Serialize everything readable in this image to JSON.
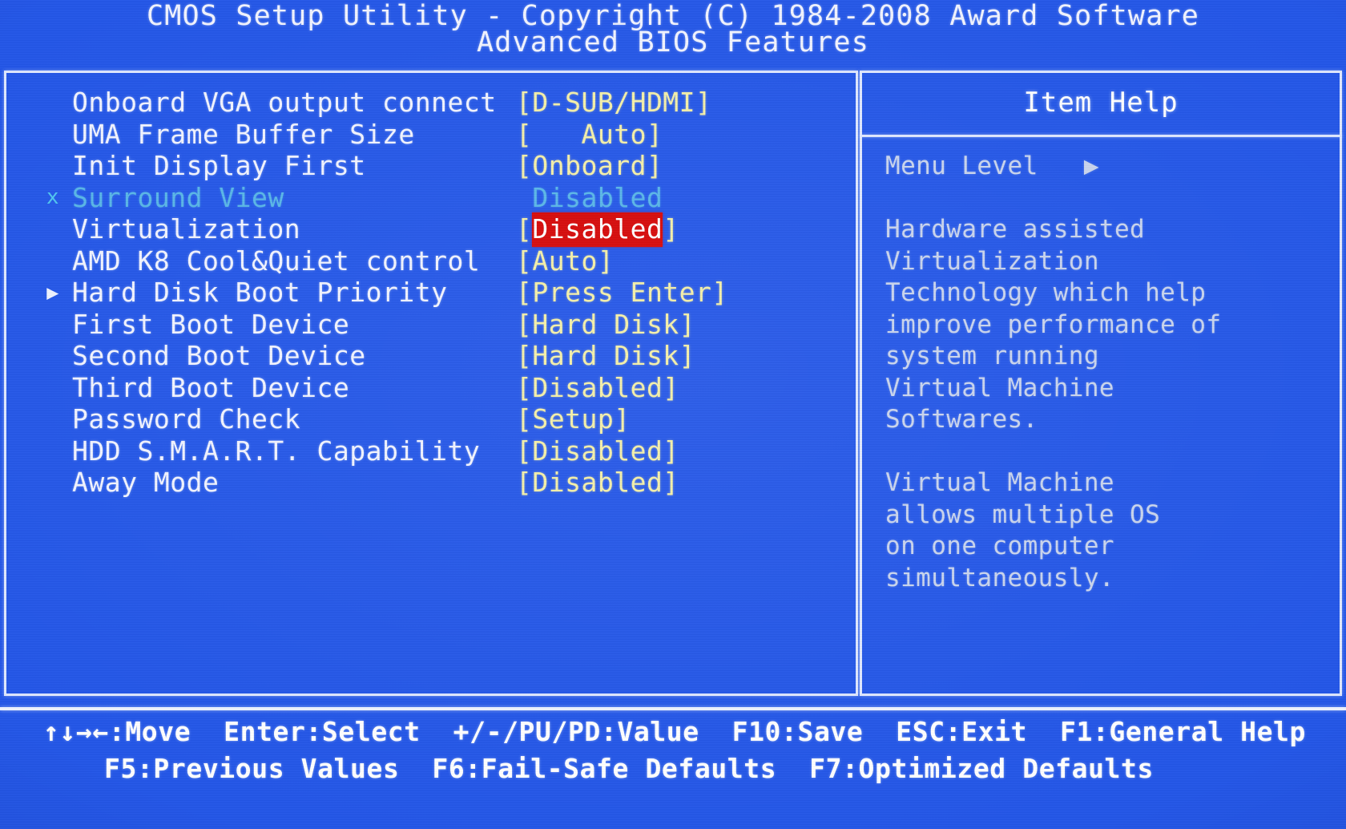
{
  "header": {
    "line1": "CMOS Setup Utility - Copyright (C) 1984-2008 Award Software",
    "line2": "Advanced BIOS Features"
  },
  "settings": [
    {
      "marker": "",
      "label": "Onboard VGA output connect",
      "value": "[D-SUB/HDMI]",
      "value_x": 598,
      "state": "normal",
      "highlight": false
    },
    {
      "marker": "",
      "label": "UMA Frame Buffer Size",
      "value": "[   Auto]",
      "value_x": 598,
      "state": "normal",
      "highlight": false
    },
    {
      "marker": "",
      "label": "Init Display First",
      "value": "[Onboard]",
      "value_x": 598,
      "state": "normal",
      "highlight": false
    },
    {
      "marker": "x",
      "label": "Surround View",
      "value": " Disabled",
      "value_x": 598,
      "state": "disabled",
      "highlight": false
    },
    {
      "marker": "",
      "label": "Virtualization",
      "value": "Disabled",
      "value_x": 598,
      "state": "normal",
      "highlight": true,
      "open_bracket": "[",
      "close_bracket": "]"
    },
    {
      "marker": "",
      "label": "AMD K8 Cool&Quiet control",
      "value": "[Auto]",
      "value_x": 598,
      "state": "normal",
      "highlight": false
    },
    {
      "marker": "▶",
      "label": "Hard Disk Boot Priority",
      "value": "[Press Enter]",
      "value_x": 598,
      "state": "normal",
      "highlight": false
    },
    {
      "marker": "",
      "label": "First Boot Device",
      "value": "[Hard Disk]",
      "value_x": 598,
      "state": "normal",
      "highlight": false
    },
    {
      "marker": "",
      "label": "Second Boot Device",
      "value": "[Hard Disk]",
      "value_x": 598,
      "state": "normal",
      "highlight": false
    },
    {
      "marker": "",
      "label": "Third Boot Device",
      "value": "[Disabled]",
      "value_x": 598,
      "state": "normal",
      "highlight": false
    },
    {
      "marker": "",
      "label": "Password Check",
      "value": "[Setup]",
      "value_x": 598,
      "state": "normal",
      "highlight": false
    },
    {
      "marker": "",
      "label": "HDD S.M.A.R.T. Capability",
      "value": "[Disabled]",
      "value_x": 598,
      "state": "normal",
      "highlight": false
    },
    {
      "marker": "",
      "label": "Away Mode",
      "value": "[Disabled]",
      "value_x": 598,
      "state": "normal",
      "highlight": false
    }
  ],
  "item_help": {
    "title": "Item Help",
    "menu_level_label": "Menu Level",
    "menu_level_arrow": "▶",
    "lines": [
      "Menu Level   ▶",
      "",
      "Hardware assisted",
      "Virtualization",
      "Technology which help",
      "improve performance of",
      "system running",
      "Virtual Machine",
      "Softwares.",
      "",
      "Virtual Machine",
      "allows multiple OS",
      "on one computer",
      "simultaneously."
    ]
  },
  "footer": {
    "line1": "↑↓→←:Move  Enter:Select  +/-/PU/PD:Value  F10:Save  ESC:Exit  F1:General Help",
    "line2": "F5:Previous Values  F6:Fail-Safe Defaults  F7:Optimized Defaults"
  },
  "colors": {
    "background": "#2356e8",
    "text": "#f2f4ff",
    "value": "#f5f0a8",
    "disabled": "#57b6e8",
    "highlight_bg": "#d60606",
    "highlight_fg": "#ffffff",
    "border": "#dfe8ff"
  }
}
